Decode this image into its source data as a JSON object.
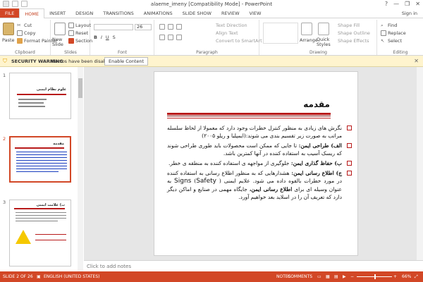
{
  "window": {
    "title": "alaeme_imeny [Compatibility Mode] - PowerPoint",
    "controls": [
      "?",
      "—",
      "❐",
      "✕"
    ]
  },
  "tabs": [
    "FILE",
    "HOME",
    "INSERT",
    "DESIGN",
    "TRANSITIONS",
    "ANIMATIONS",
    "SLIDE SHOW",
    "REVIEW",
    "VIEW"
  ],
  "sign_in": "Sign in",
  "ribbon": {
    "clipboard": {
      "paste": "Paste",
      "cut": "Cut",
      "copy": "Copy",
      "format_painter": "Format Painter",
      "label": "Clipboard"
    },
    "slides": {
      "new_slide": "New Slide",
      "layout": "Layout",
      "reset": "Reset",
      "section": "Section",
      "label": "Slides"
    },
    "font": {
      "size": "26",
      "label": "Font"
    },
    "paragraph": {
      "text_direction": "Text Direction",
      "align_text": "Align Text",
      "smartart": "Convert to SmartArt",
      "label": "Paragraph"
    },
    "drawing": {
      "arrange": "Arrange",
      "quick_styles": "Quick Styles",
      "shape_fill": "Shape Fill",
      "shape_outline": "Shape Outline",
      "shape_effects": "Shape Effects",
      "label": "Drawing"
    },
    "editing": {
      "find": "Find",
      "replace": "Replace",
      "select": "Select",
      "label": "Editing"
    }
  },
  "security": {
    "label": "SECURITY WARNING",
    "message": "Macros have been disabled.",
    "button": "Enable Content"
  },
  "thumbnails": [
    {
      "num": "1",
      "title": "علوم نظام ايمنی"
    },
    {
      "num": "2",
      "title": "مقدمه"
    },
    {
      "num": "3",
      "title": "ب) علامت ايمنی"
    }
  ],
  "slide": {
    "title": "مقدمه",
    "bullets": [
      {
        "text": "نگرش های زيادی به منظور کنترل خطرات وجود دارد که معمولا از لحاظ سلسله مراتب به صورت زير تقسيم بندی می شوند:(ايمپليا و ريلو ۲۰۰۵)"
      },
      {
        "lead": "الف) طراحی ايمن:",
        "text": " تا جايی که ممکن است  محصولات بايد طوری طراحی شوند که ريسک آسيب به استفاده کننده در آنها کمترين باشد."
      },
      {
        "lead": "ب) حفاظ گذاری ايمن:",
        "text": " جلوگيری از مواجهه ی استفاده کننده به منطقه ی خطر."
      },
      {
        "lead": "ج) اطلاع رسانی ايمن:",
        "text": " هشدارهايی که به منظور اطلاع رسانی به استفاده کننده در مورد خطرات بالقوه داده می شود. علايم ايمنی ( ",
        "sig1": "Safety",
        "mid": ") ",
        "sig2": "Signs",
        "tail": " به عنوان وسيله ای برای ",
        "lead2": "اطلاع رسانی ايمن،",
        "tail2": " جايگاه مهمی در صنايع و اماکن ديگر دارد که تعريف آن را در اسلايد بعد خواهيم آورد."
      }
    ]
  },
  "notes_placeholder": "Click to add notes",
  "status": {
    "slide_count": "SLIDE 2 OF 26",
    "language": "ENGLISH (UNITED STATES)",
    "notes": "NOTES",
    "comments": "COMMENTS",
    "zoom": "66%"
  },
  "colors": {
    "accent": "#d24726",
    "slide_red": "#b81a1a",
    "warning_bar": "#fff4ce"
  }
}
